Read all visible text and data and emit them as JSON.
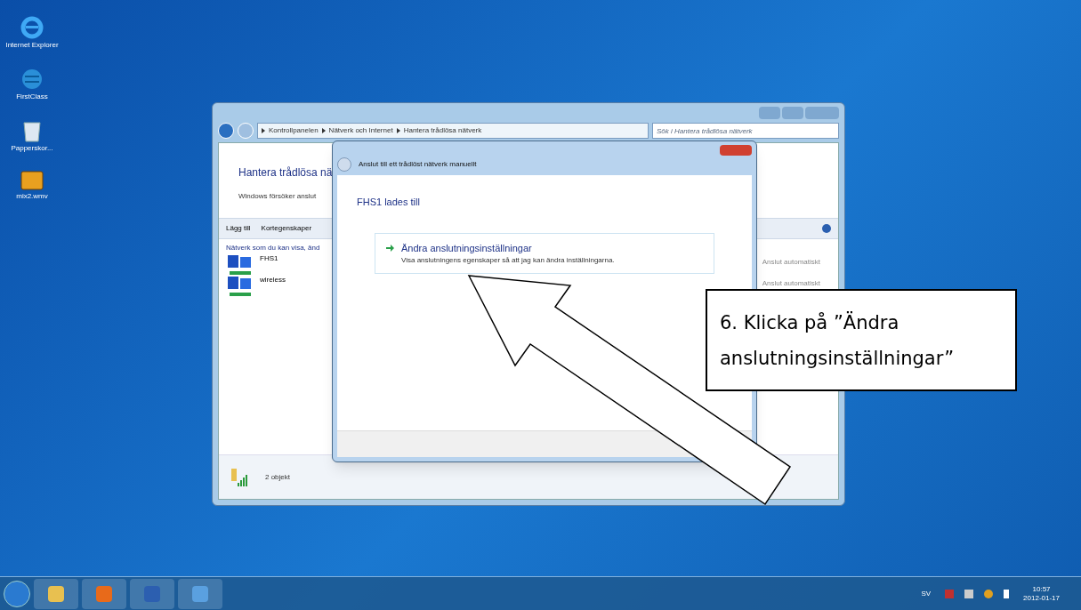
{
  "desktop_icons": [
    {
      "label": "Internet Explorer",
      "kind": "browser"
    },
    {
      "label": "FirstClass",
      "kind": "globe"
    },
    {
      "label": "Papperskor...",
      "kind": "bin"
    },
    {
      "label": "mix2.wmv",
      "kind": "video"
    }
  ],
  "main_window": {
    "breadcrumb": [
      "Kontrollpanelen",
      "Nätverk och Internet",
      "Hantera trådlösa nätverk"
    ],
    "search_placeholder": "Sök i Hantera trådlösa nätverk",
    "heading": "Hantera trådlösa nä",
    "description": "Windows försöker anslut",
    "toolbar": [
      "Lägg till",
      "Kortegenskaper"
    ],
    "list_header": "Nätverk som du kan visa, änd",
    "networks": [
      {
        "name": "FHS1",
        "mode": "Anslut automatiskt"
      },
      {
        "name": "wireless",
        "mode": "Anslut automatiskt"
      }
    ],
    "status": "2 objekt"
  },
  "dialog": {
    "title": "Anslut till ett trådlöst nätverk manuellt",
    "heading": "FHS1 lades till",
    "option": {
      "title": "Ändra anslutningsinställningar",
      "description": "Visa anslutningens egenskaper så att jag kan ändra inställningarna."
    }
  },
  "callout": "6. Klicka på ”Ändra anslutningsinställningar”",
  "taskbar": {
    "pinned": [
      {
        "kind": "explorer"
      },
      {
        "kind": "media"
      },
      {
        "kind": "word"
      },
      {
        "kind": "control"
      }
    ],
    "language": "SV",
    "time": "10:57",
    "date": "2012-01-17"
  }
}
